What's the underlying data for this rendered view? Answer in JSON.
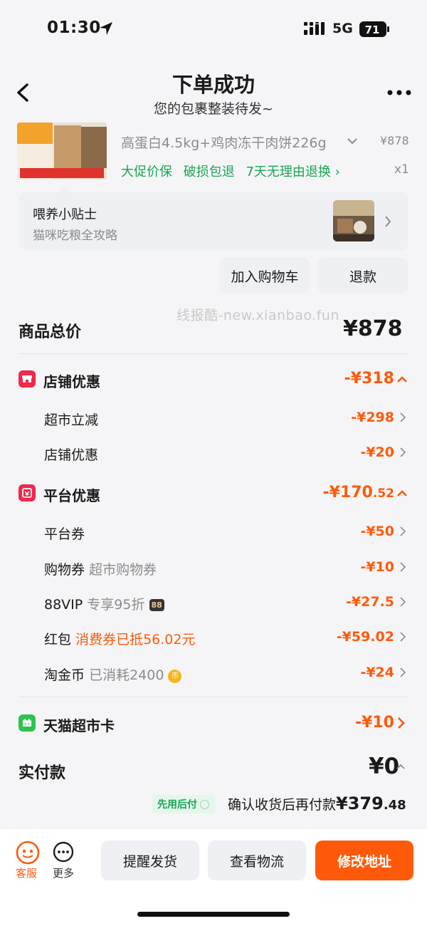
{
  "status_bar": {
    "time": "01:30",
    "network": "5G",
    "battery": "71"
  },
  "header": {
    "title": "下单成功",
    "subtitle": "您的包裹整装待发~"
  },
  "product": {
    "name": "高蛋白4.5kg+鸡肉冻干肉饼226g",
    "price": "¥878",
    "tags": [
      "大促价保",
      "破损包退",
      "7天无理由退换 ›"
    ],
    "quantity": "x1"
  },
  "tip": {
    "title": "喂养小贴士",
    "subtitle": "猫咪吃粮全攻略"
  },
  "buttons": {
    "add_cart": "加入购物车",
    "refund": "退款"
  },
  "watermark": "线报酷-new.xianbao.fun",
  "summary": {
    "total_label": "商品总价",
    "total_value": "¥878",
    "store": {
      "label": "店铺优惠",
      "value": "-¥318",
      "rows": [
        {
          "label": "超市立减",
          "value": "-¥298"
        },
        {
          "label": "店铺优惠",
          "value": "-¥20"
        }
      ]
    },
    "platform": {
      "label": "平台优惠",
      "value_main": "-¥170",
      "value_dec": ".52",
      "rows": [
        {
          "label": "平台券",
          "note": "",
          "value": "-¥50"
        },
        {
          "label": "购物券",
          "note": "超市购物券",
          "value": "-¥10"
        },
        {
          "label": "88VIP",
          "note": "专享95折",
          "badge": "88",
          "value": "-¥27.5"
        },
        {
          "label": "红包",
          "note": "消费券已抵56.02元",
          "value": "-¥59.02"
        },
        {
          "label": "淘金币",
          "note": "已消耗2400",
          "coin": "币",
          "value": "-¥24"
        }
      ]
    },
    "card": {
      "label": "天猫超市卡",
      "value": "-¥10"
    },
    "paid_label": "实付款",
    "paid_value": "¥0",
    "pay_later_badge": "先用后付",
    "pay_after_text": "确认收货后再付款",
    "pay_after_main": "¥379",
    "pay_after_dec": ".48"
  },
  "bottom": {
    "service": "客服",
    "more": "更多",
    "remind": "提醒发货",
    "track": "查看物流",
    "modify": "修改地址"
  },
  "colors": {
    "accent": "#ff5a0a",
    "green": "#19a654",
    "store_red": "#f0284a",
    "card_green": "#2bc44e"
  },
  "icons": {
    "location": "location-arrow-icon",
    "back": "back-chevron-icon",
    "more": "more-dots-icon",
    "store": "store-icon",
    "platform": "platform-coupon-icon",
    "card": "supermarket-card-icon"
  }
}
